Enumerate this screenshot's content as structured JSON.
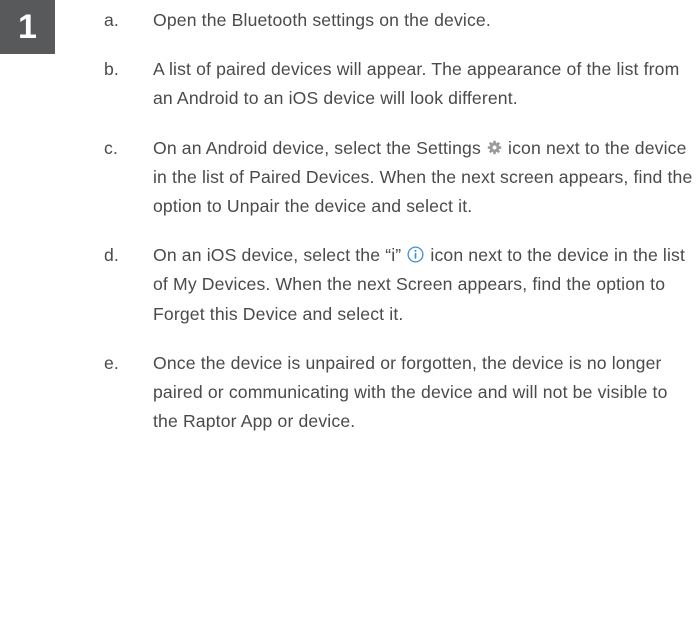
{
  "step": {
    "number": "1"
  },
  "items": [
    {
      "letter": "a.",
      "text": "Open the Bluetooth settings on the device."
    },
    {
      "letter": "b.",
      "text": "A list of paired devices will appear. The appearance of the list from an Android to an iOS device will look different."
    },
    {
      "letter": "c.",
      "text_before": "On an Android device, select the Settings",
      "text_after": "icon next to the device in the list of Paired Devices. When the next screen appears, find the option to Unpair the device and select it.",
      "icon": "gear-icon"
    },
    {
      "letter": "d.",
      "text_before": "On an iOS device, select the “i”",
      "text_after": "icon next to the device in the list of My Devices. When the next Screen appears, find the option to Forget this Device and select it.",
      "icon": "info-icon"
    },
    {
      "letter": "e.",
      "text": "Once the device is unpaired or forgotten, the device is no longer paired or communicating with the device and will not be visible to the Raptor App or device."
    }
  ],
  "colors": {
    "badge_bg": "#58595b",
    "text": "#4a4a4a",
    "gear": "#9b9b9b",
    "info": "#3b8fd6"
  }
}
